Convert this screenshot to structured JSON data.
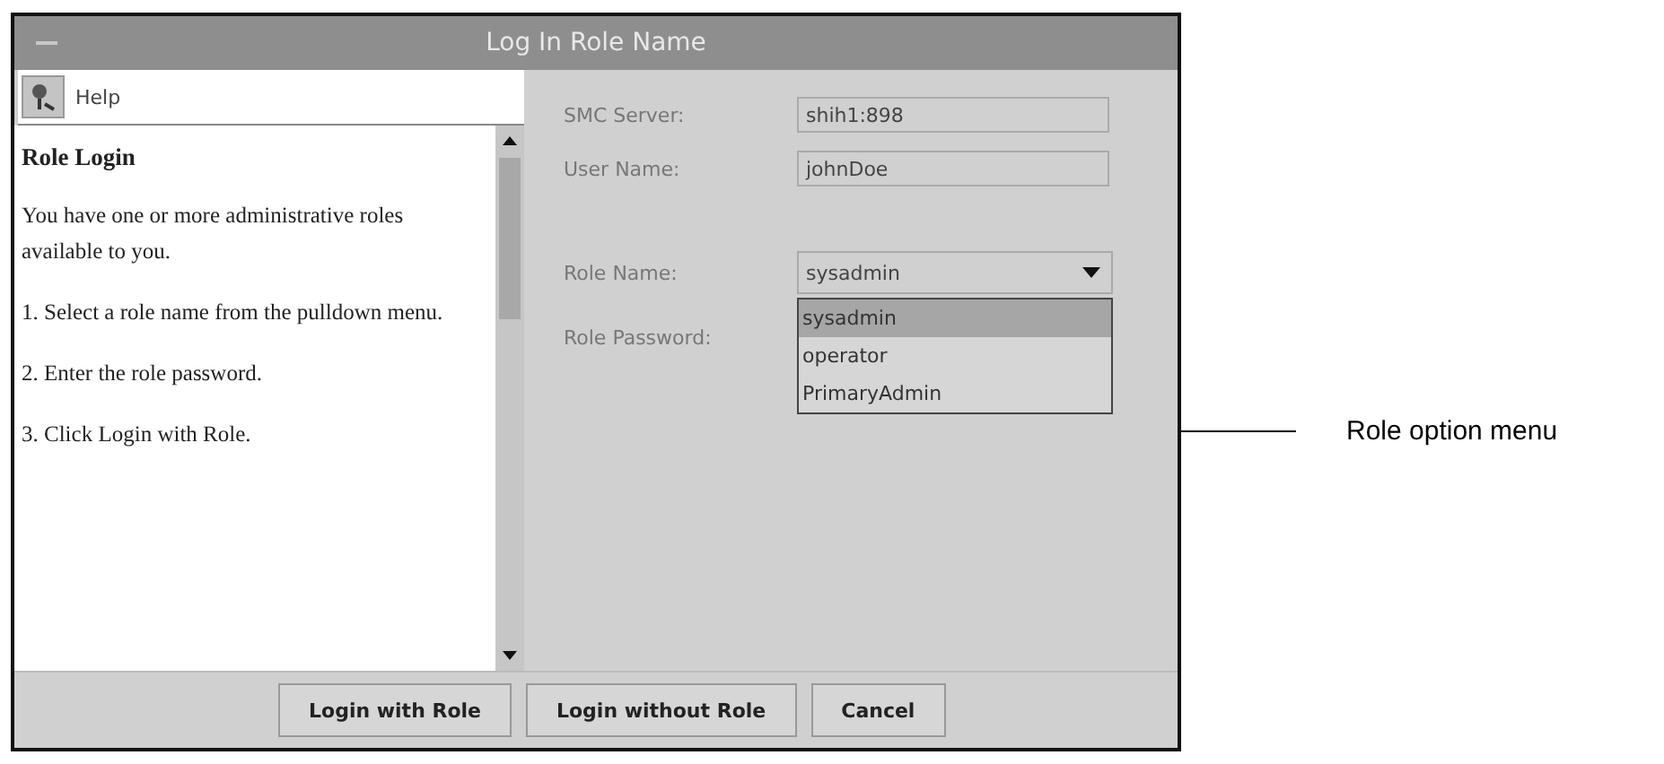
{
  "window": {
    "title": "Log In Role Name"
  },
  "help": {
    "title": "Help",
    "heading": "Role Login",
    "paragraphs": [
      "You have one or more administrative roles available to you.",
      "1. Select a role name from the pulldown menu.",
      "2. Enter the role password.",
      "3. Click Login with Role."
    ]
  },
  "fields": [
    {
      "kind": "text",
      "label": "SMC Server:",
      "value": "shih1:898"
    },
    {
      "kind": "text",
      "label": "User Name:",
      "value": "johnDoe"
    },
    {
      "kind": "select",
      "label": "Role Name:",
      "value": "sysadmin",
      "options": [
        {
          "label": "sysadmin",
          "selected": true
        },
        {
          "label": "operator",
          "selected": false
        },
        {
          "label": "PrimaryAdmin",
          "selected": false
        }
      ]
    },
    {
      "kind": "password",
      "label": "Role Password:"
    }
  ],
  "buttons": [
    "Login with Role",
    "Login without Role",
    "Cancel"
  ],
  "callout": "Role option menu"
}
